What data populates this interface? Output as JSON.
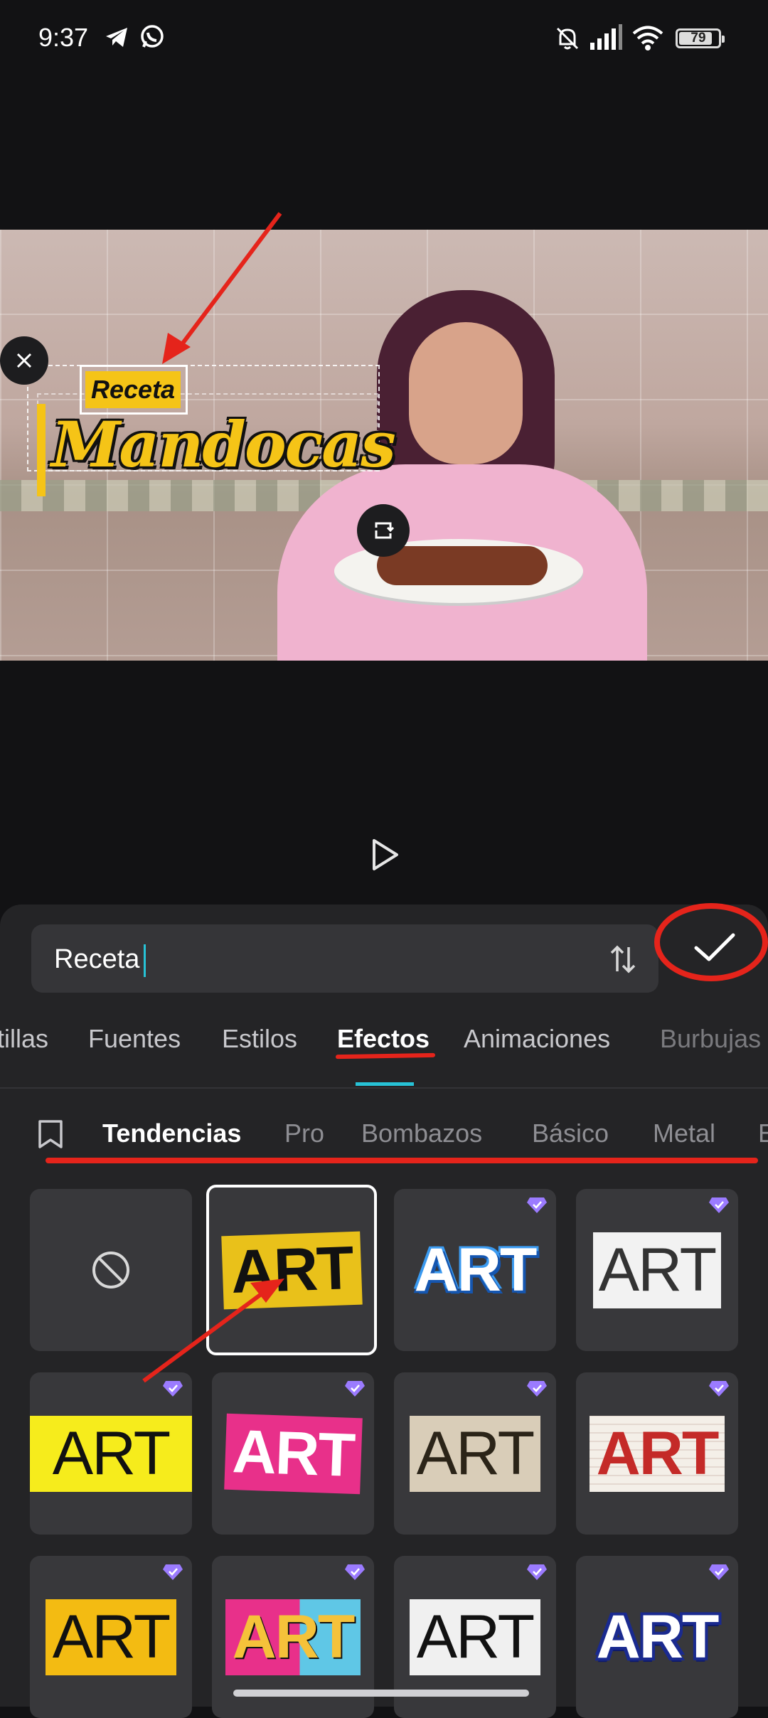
{
  "status_bar": {
    "time": "9:37",
    "battery": "79"
  },
  "preview": {
    "overlay_small_text": "Receta",
    "overlay_title_text": "Mandocas"
  },
  "editor": {
    "text_value": "Receta"
  },
  "tabs": [
    {
      "label": "tillas"
    },
    {
      "label": "Fuentes"
    },
    {
      "label": "Estilos"
    },
    {
      "label": "Efectos",
      "active": true
    },
    {
      "label": "Animaciones"
    },
    {
      "label": "Burbujas"
    }
  ],
  "subtabs": [
    {
      "label": "Tendencias",
      "active": true
    },
    {
      "label": "Pro"
    },
    {
      "label": "Bombazos"
    },
    {
      "label": "Básico"
    },
    {
      "label": "Metal"
    },
    {
      "label": "E"
    }
  ],
  "effects": [
    {
      "label": "none",
      "icon": "no-effect-icon"
    },
    {
      "label": "ART",
      "style": "yellow-paper",
      "selected": true
    },
    {
      "label": "ART",
      "style": "blue-bubble",
      "premium": true
    },
    {
      "label": "ART",
      "style": "white-paper",
      "premium": true
    },
    {
      "label": "ART",
      "style": "yellow-torn",
      "premium": true
    },
    {
      "label": "ART",
      "style": "pink-paper",
      "premium": true
    },
    {
      "label": "ART",
      "style": "beige-paper",
      "premium": true
    },
    {
      "label": "ART",
      "style": "red-notebook",
      "premium": true
    },
    {
      "label": "ART",
      "style": "yellow-grunge",
      "premium": true
    },
    {
      "label": "ART",
      "style": "pink-cyan",
      "premium": true
    },
    {
      "label": "ART",
      "style": "white-grunge",
      "premium": true
    },
    {
      "label": "ART",
      "style": "navy-bubble",
      "premium": true
    }
  ],
  "colors": {
    "accent": "#27c2d6",
    "annotation": "#e5241b",
    "panel": "#242426",
    "cell": "#38383b"
  }
}
